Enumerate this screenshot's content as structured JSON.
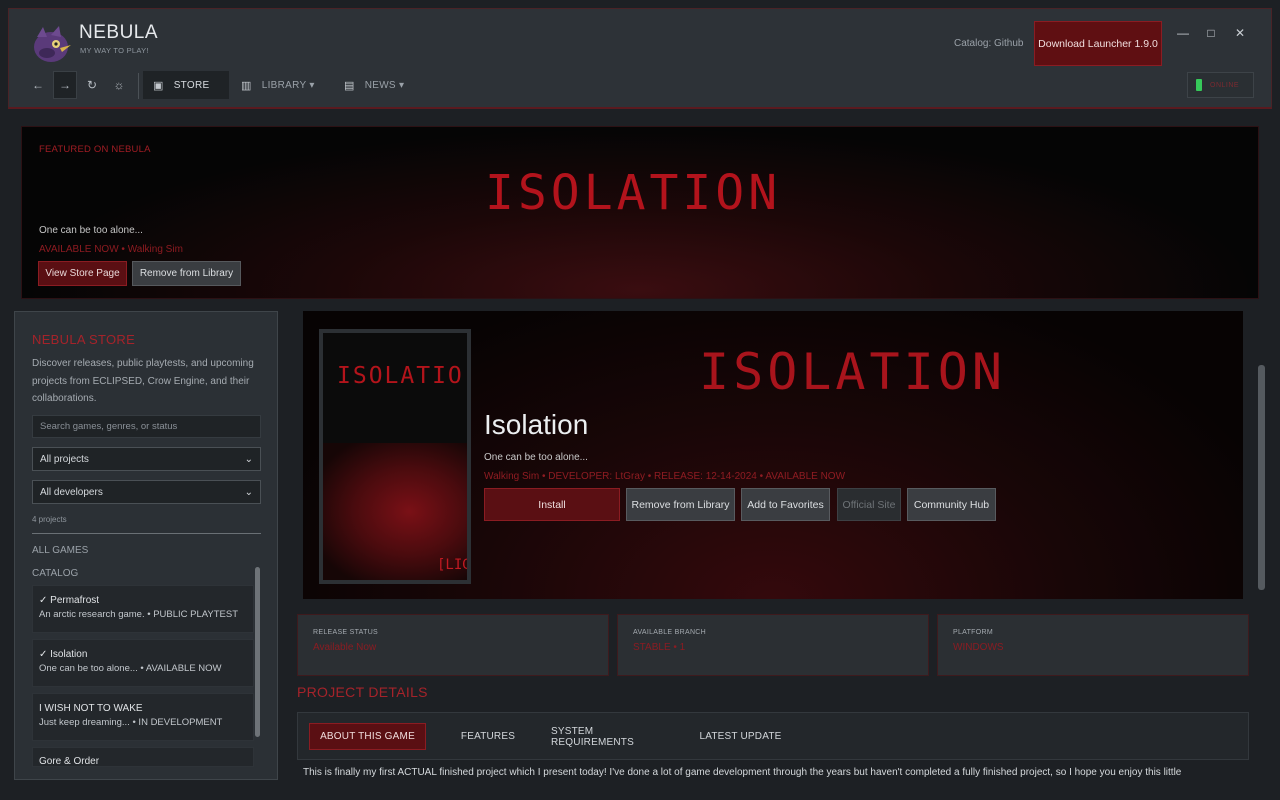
{
  "brand": {
    "name": "NEBULA",
    "tagline": "MY WAY TO PLAY!"
  },
  "header": {
    "catalog_label": "Catalog: Github",
    "download_label": "Download Launcher 1.9.0",
    "online_label": "ONLINE",
    "window_controls": {
      "minimize": "—",
      "maximize": "□",
      "close": "✕"
    }
  },
  "nav": {
    "back": "←",
    "forward": "→",
    "refresh": "↻",
    "settings": "☼",
    "store_label": "STORE",
    "library_label": "LIBRARY ▾",
    "news_label": "NEWS ▾"
  },
  "featured": {
    "label": "FEATURED ON NEBULA",
    "title": "ISOLATION",
    "tagline": "One can be too alone...",
    "meta": "AVAILABLE NOW  •  Walking Sim",
    "view_button": "View Store Page",
    "remove_button": "Remove from Library"
  },
  "sidebar": {
    "title": "NEBULA STORE",
    "description": "Discover releases, public playtests, and upcoming projects from ECLIPSED, Crow Engine, and their collaborations.",
    "search_placeholder": "Search games, genres, or status",
    "project_filter": "All projects",
    "developer_filter": "All developers",
    "project_count": "4 projects",
    "all_games": "ALL GAMES",
    "catalog_heading": "CATALOG",
    "games": [
      {
        "title": "✓  Permafrost",
        "subtitle": "An arctic research game.  •  PUBLIC PLAYTEST"
      },
      {
        "title": "✓  Isolation",
        "subtitle": "One can be too alone...  •  AVAILABLE NOW"
      },
      {
        "title": "I WISH NOT TO WAKE",
        "subtitle": "Just keep dreaming...  •  IN DEVELOPMENT"
      },
      {
        "title": "Gore & Order",
        "subtitle": ""
      }
    ]
  },
  "game": {
    "hero_title": "ISOLATION",
    "cover_title": "ISOLATIO",
    "cover_tag": "[LIG",
    "title": "Isolation",
    "tagline": "One can be too alone...",
    "meta": "Walking Sim  •  DEVELOPER: LtGray  •  RELEASE: 12-14-2024  •  AVAILABLE NOW",
    "buttons": {
      "install": "Install",
      "remove": "Remove from Library",
      "favorites": "Add to Favorites",
      "site": "Official Site",
      "hub": "Community Hub"
    }
  },
  "info_cards": [
    {
      "label": "RELEASE STATUS",
      "value": "Available Now"
    },
    {
      "label": "AVAILABLE BRANCH",
      "value": "STABLE • 1"
    },
    {
      "label": "PLATFORM",
      "value": "WINDOWS"
    }
  ],
  "details": {
    "title": "PROJECT DETAILS",
    "tabs": [
      "ABOUT THIS GAME",
      "FEATURES",
      "SYSTEM REQUIREMENTS",
      "LATEST UPDATE"
    ],
    "about_text": "This is finally my first ACTUAL finished project which I present today! I've done a lot of game development through the years but haven't completed a fully finished project, so I hope you enjoy this little"
  },
  "colors": {
    "accent": "#8b1c22",
    "accent_text": "#a5232a",
    "online": "#36c95a"
  }
}
